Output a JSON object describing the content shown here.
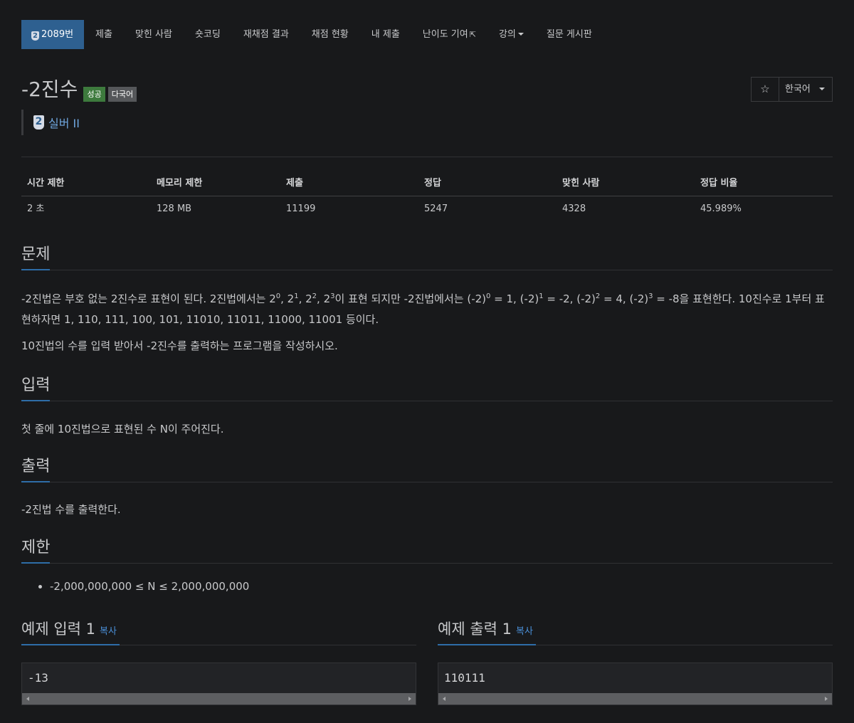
{
  "nav": {
    "problem_tab": {
      "tier_icon": "2",
      "label": "2089번"
    },
    "items": [
      "제출",
      "맞힌 사람",
      "숏코딩",
      "재채점 결과",
      "채점 현황",
      "내 제출",
      "난이도 기여",
      "강의"
    ],
    "board": "질문 게시판"
  },
  "header": {
    "title": "-2진수",
    "label_success": "성공",
    "label_lang": "다국어",
    "star": "☆",
    "language": "한국어",
    "tier_number": "2",
    "tier_name": "실버 II"
  },
  "stats": {
    "headers": [
      "시간 제한",
      "메모리 제한",
      "제출",
      "정답",
      "맞힌 사람",
      "정답 비율"
    ],
    "values": [
      "2 초",
      "128 MB",
      "11199",
      "5247",
      "4328",
      "45.989%"
    ]
  },
  "problem": {
    "heading": "문제",
    "p1_a": "-2진법은 부호 없는 2진수로 표현이 된다. 2진법에서는 2",
    "sup0": "0",
    "p1_b": ", 2",
    "sup1": "1",
    "p1_c": ", 2",
    "sup2": "2",
    "p1_d": ", 2",
    "sup3": "3",
    "p1_e": "이 표현 되지만 -2진법에서는 (-2)",
    "p1_f": " = 1, (-2)",
    "p1_g": " = -2, (-2)",
    "p1_h": " = 4, (-2)",
    "p1_i": " = -8을 표현한다. 10진수로 1부터 표현하자면 1, 110, 111, 100, 101, 11010, 11011, 11000, 11001 등이다.",
    "p2": "10진법의 수를 입력 받아서 -2진수를 출력하는 프로그램을 작성하시오."
  },
  "input": {
    "heading": "입력",
    "text": "첫 줄에 10진법으로 표현된 수 N이 주어진다."
  },
  "output": {
    "heading": "출력",
    "text": "-2진법 수를 출력한다."
  },
  "limits": {
    "heading": "제한",
    "item": "-2,000,000,000 ≤ N ≤ 2,000,000,000"
  },
  "samples": {
    "input_heading": "예제 입력 1",
    "output_heading": "예제 출력 1",
    "copy": "복사",
    "input_value": "-13",
    "output_value": "110111"
  },
  "colors": {
    "accent": "#2e6090",
    "success": "#3d7a3d",
    "link": "#4a90d9",
    "background": "#18191b"
  }
}
